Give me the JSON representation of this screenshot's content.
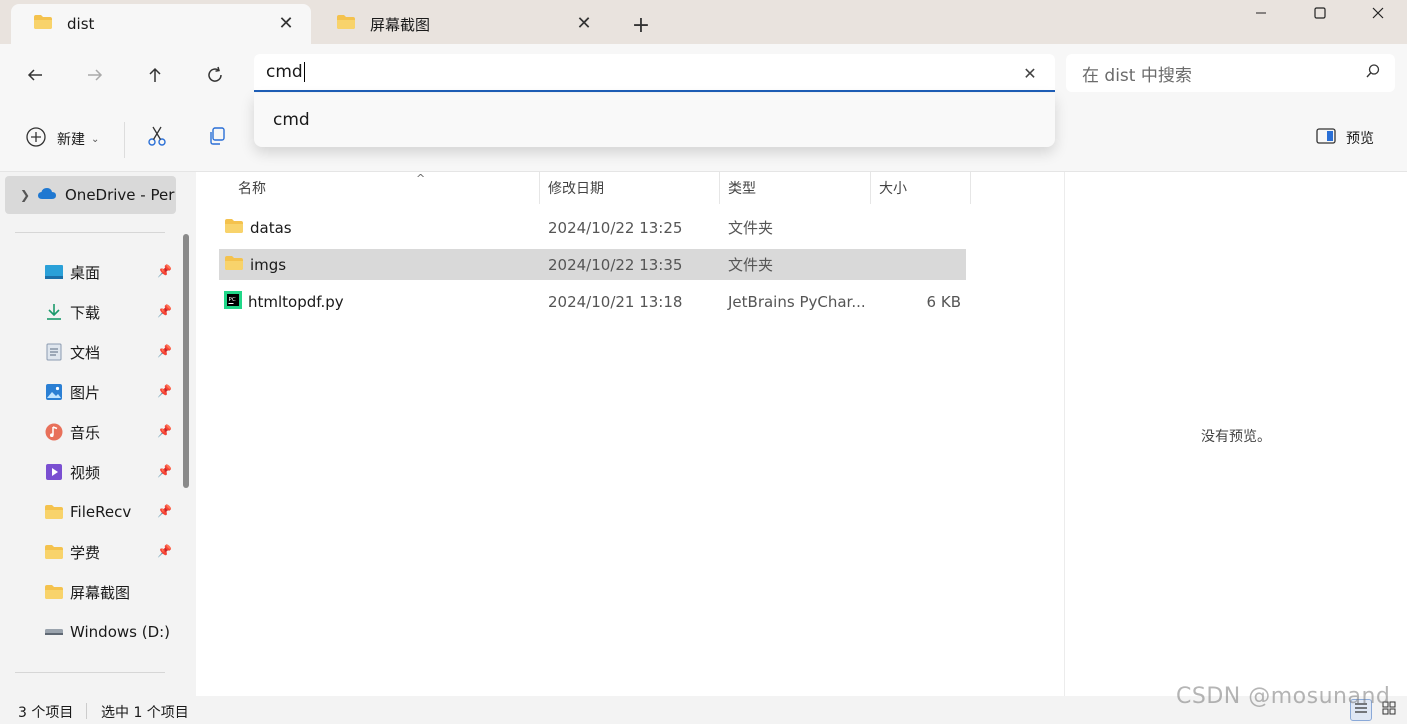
{
  "tabs": [
    {
      "label": "dist",
      "active": true
    },
    {
      "label": "屏幕截图",
      "active": false
    }
  ],
  "address": {
    "value": "cmd"
  },
  "search": {
    "placeholder": "在 dist 中搜索"
  },
  "suggestion": {
    "text": "cmd"
  },
  "toolbar": {
    "new_label": "新建",
    "preview_label": "预览"
  },
  "sidebar": {
    "onedrive": "OneDrive - Per",
    "items": [
      {
        "label": "桌面",
        "icon": "desktop-icon",
        "pinned": true
      },
      {
        "label": "下载",
        "icon": "download-icon",
        "pinned": true
      },
      {
        "label": "文档",
        "icon": "documents-icon",
        "pinned": true
      },
      {
        "label": "图片",
        "icon": "pictures-icon",
        "pinned": true
      },
      {
        "label": "音乐",
        "icon": "music-icon",
        "pinned": true
      },
      {
        "label": "视频",
        "icon": "videos-icon",
        "pinned": true
      },
      {
        "label": "FileRecv",
        "icon": "folder-icon",
        "pinned": true
      },
      {
        "label": "学费",
        "icon": "folder-icon",
        "pinned": true
      },
      {
        "label": "屏幕截图",
        "icon": "folder-icon",
        "pinned": false
      },
      {
        "label": "Windows (D:)",
        "icon": "drive-icon",
        "pinned": false
      }
    ]
  },
  "columns": {
    "name": "名称",
    "date": "修改日期",
    "type": "类型",
    "size": "大小"
  },
  "files": [
    {
      "name": "datas",
      "date": "2024/10/22 13:25",
      "type": "文件夹",
      "size": "",
      "icon": "folder-icon",
      "selected": false
    },
    {
      "name": "imgs",
      "date": "2024/10/22 13:35",
      "type": "文件夹",
      "size": "",
      "icon": "folder-icon",
      "selected": true
    },
    {
      "name": "htmltopdf.py",
      "date": "2024/10/21 13:18",
      "type": "JetBrains PyChar...",
      "size": "6 KB",
      "icon": "pycharm-file-icon",
      "selected": false
    }
  ],
  "preview": {
    "message": "没有预览。"
  },
  "status": {
    "count": "3 个项目",
    "selected": "选中 1 个项目"
  },
  "watermark": "CSDN @mosunand",
  "colors": {
    "accent": "#1f5fb8",
    "folder": "#f4c24d",
    "selected_row": "#d9d9d9",
    "tabbar": "#e9e3de"
  }
}
